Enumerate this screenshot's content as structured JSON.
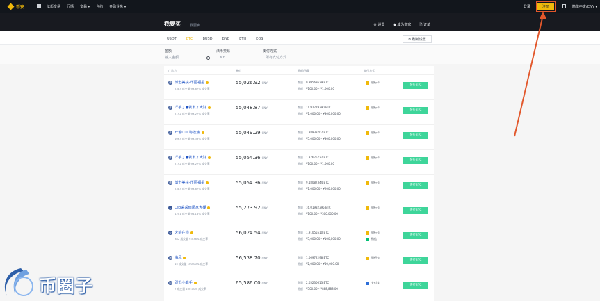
{
  "topbar": {
    "logo_text": "币安",
    "nav": [
      "法币交易",
      "行情",
      "交易 ▾",
      "合约",
      "金融业务 ▾"
    ],
    "login_label": "登录",
    "register_label": "注册",
    "lang_label": "简体中文/CNY ▾"
  },
  "hero": {
    "title": "我要买",
    "subtitle": "我要卖",
    "actions": [
      "⚙ 设置",
      "● 成为商家",
      "🗎 订单"
    ]
  },
  "tabs": {
    "coins": [
      "USDT",
      "BTC",
      "BUSD",
      "BNB",
      "ETH",
      "EOS"
    ],
    "active": "BTC",
    "refresh_label": "↻ 刷新设置"
  },
  "filter": {
    "amount_label": "金额",
    "amount_placeholder": "输入金额",
    "currency_label": "法币交易",
    "currency_value": "CNY",
    "payment_label": "支付方式",
    "payment_value": "所有支付方式"
  },
  "table": {
    "headers": {
      "advertiser": "广告方",
      "price": "单价",
      "limit": "限额/数量",
      "payment": "支付方式"
    },
    "qty_key": "数量",
    "limit_key": "限额",
    "currency": "CNY",
    "buy_label": "购买BTC",
    "rows": [
      {
        "avatar": "博",
        "name": "博士美境-币圈福星",
        "stats": "2383 成交量   99.67% 成交率",
        "price": "55,026.92",
        "qty": "0.99563629 BTC",
        "limit": "¥100.00 - ¥1,000.00",
        "payments": [
          {
            "type": "bank",
            "label": "银行卡"
          }
        ]
      },
      {
        "avatar": "洋",
        "name": "洋芋丁●就发了大财",
        "stats": "2192 成交量   99.27% 成交率",
        "price": "55,048.87",
        "qty": "11.92779390 BTC",
        "limit": "¥1,000.00 - ¥300,000.00",
        "payments": [
          {
            "type": "bank",
            "label": "银行卡"
          }
        ]
      },
      {
        "avatar": "开",
        "name": "开着OTC称收簇",
        "stats": "1063 成交量   99.33% 成交率",
        "price": "55,049.29",
        "qty": "7.38933707 BTC",
        "limit": "¥5,000.00 - ¥300,000.00",
        "payments": [
          {
            "type": "bank",
            "label": "银行卡"
          }
        ]
      },
      {
        "avatar": "洋",
        "name": "洋芋丁●就发了大财",
        "stats": "2192 成交量   99.27% 成交率",
        "price": "55,054.36",
        "qty": "1.37675722 BTC",
        "limit": "¥100.00 - ¥1,000.00",
        "payments": [
          {
            "type": "bank",
            "label": "银行卡"
          }
        ]
      },
      {
        "avatar": "博",
        "name": "博士美境-币圈福星",
        "stats": "2383 成交量   99.67% 成交率",
        "price": "55,054.36",
        "qty": "9.18087344 BTC",
        "limit": "¥1,000.00 - ¥200,000.00",
        "payments": [
          {
            "type": "bank",
            "label": "银行卡"
          }
        ]
      },
      {
        "avatar": "L",
        "name": "Leo采采雨凤家大棚",
        "stats": "1201 成交量   98.18% 成交率",
        "price": "55,273.92",
        "qty": "16.01932395 BTC",
        "limit": "¥100.00 - ¥300,000.00",
        "payments": [
          {
            "type": "bank",
            "label": "银行卡"
          }
        ]
      },
      {
        "avatar": "火",
        "name": "火箭在线",
        "stats": "382 成交量   93.36% 成交率",
        "price": "56,024.54",
        "qty": "1.91055510 BTC",
        "limit": "¥5,000.00 - ¥100,000.00",
        "payments": [
          {
            "type": "bank",
            "label": "银行卡"
          },
          {
            "type": "wechat",
            "label": "微信"
          }
        ]
      },
      {
        "avatar": "海",
        "name": "海风",
        "stats": "15 成交量   100.00% 成交率",
        "price": "56,538.70",
        "qty": "1.06972298 BTC",
        "limit": "¥2,000.00 - ¥50,000.00",
        "payments": [
          {
            "type": "bank",
            "label": "银行卡"
          }
        ]
      },
      {
        "avatar": "即",
        "name": "即币小能手",
        "stats": "7 成交量   100.00% 成交率",
        "price": "65,586.00",
        "qty": "2.05230613 BTC",
        "limit": "¥500.00 - ¥888,888.00",
        "payments": [
          {
            "type": "alipay",
            "label": "支付宝"
          }
        ]
      }
    ]
  },
  "annotation": {
    "arrow_color": "#e2572b"
  },
  "watermark": {
    "text": "币圈子"
  }
}
